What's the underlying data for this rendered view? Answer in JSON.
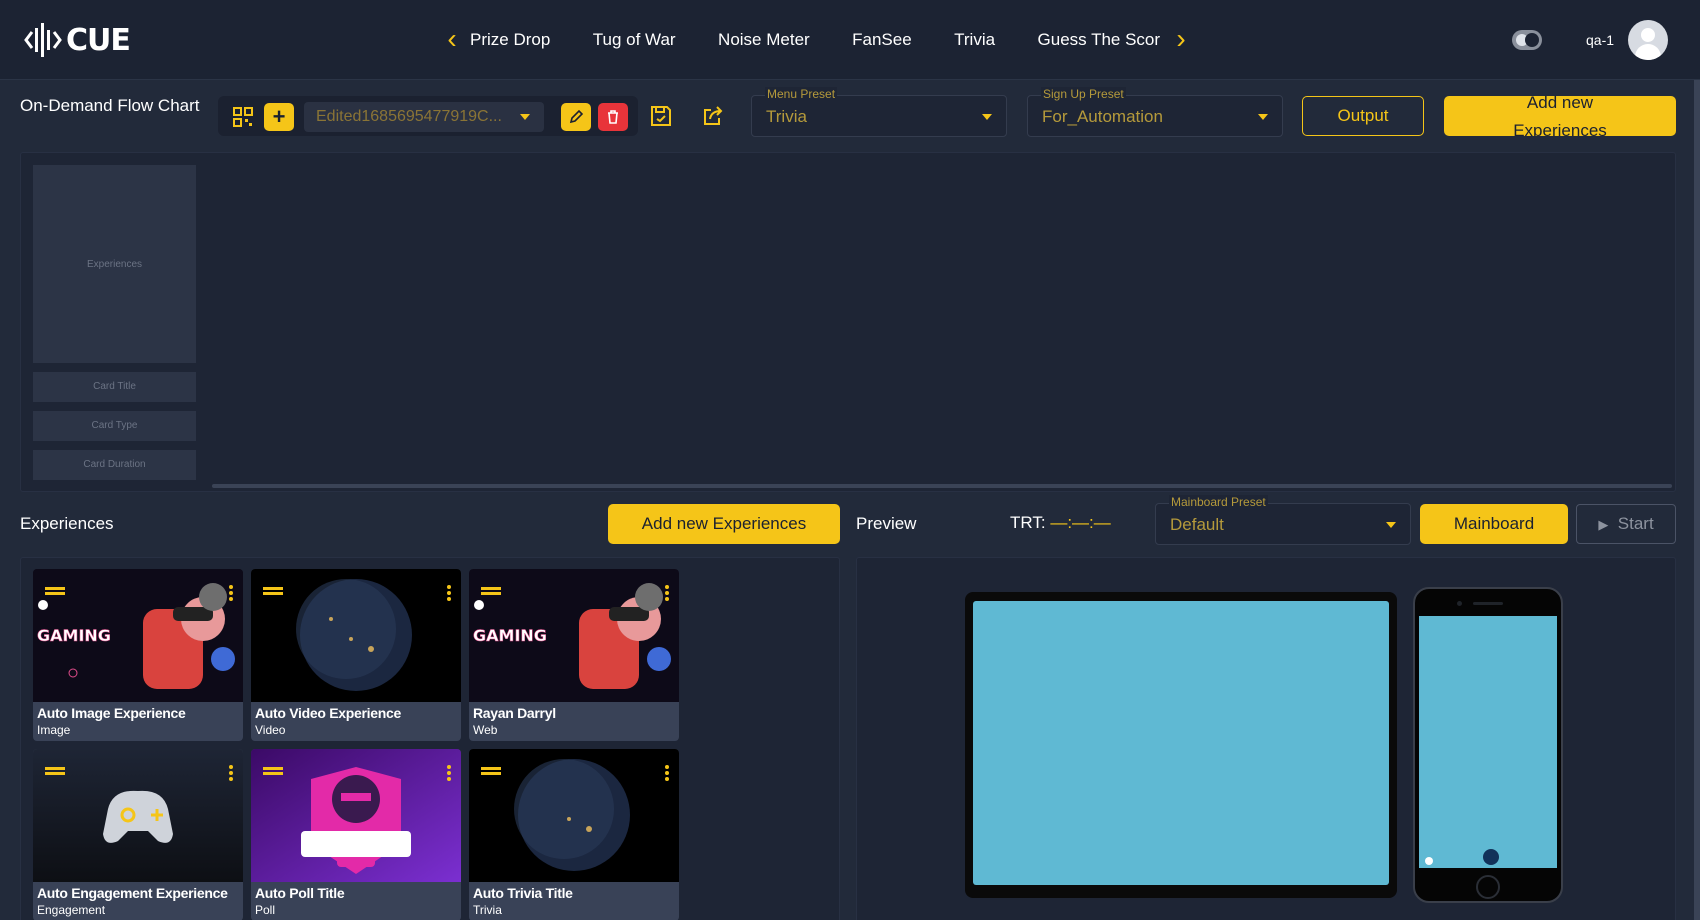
{
  "app": {
    "logo_text": "CUE"
  },
  "nav": {
    "tabs": [
      "Prize Drop",
      "Tug of War",
      "Noise Meter",
      "FanSee",
      "Trivia",
      "Guess The Score"
    ]
  },
  "user": {
    "name": "qa-1"
  },
  "flow": {
    "title": "On-Demand Flow Chart",
    "selected_flow": "Edited1685695477919C...",
    "menu_preset": {
      "label": "Menu Preset",
      "value": "Trivia"
    },
    "signup_preset": {
      "label": "Sign Up Preset",
      "value": "For_Automation"
    },
    "output_label": "Output",
    "add_new_label": "Add new Experiences",
    "placeholder": {
      "image": "Experiences",
      "card_title": "Card Title",
      "card_type": "Card Type",
      "card_duration": "Card Duration"
    }
  },
  "experiences": {
    "title": "Experiences",
    "add_label": "Add new Experiences",
    "cards": [
      {
        "title": "Auto Image Experience",
        "type": "Image"
      },
      {
        "title": "Auto Video Experience",
        "type": "Video"
      },
      {
        "title": "Rayan Darryl",
        "type": "Web"
      },
      {
        "title": "Auto Engagement Experience",
        "type": "Engagement"
      },
      {
        "title": "Auto Poll Title",
        "type": "Poll"
      },
      {
        "title": "Auto Trivia Title",
        "type": "Trivia"
      }
    ]
  },
  "preview": {
    "title": "Preview",
    "trt_label": "TRT:",
    "trt_value": "—:—:—",
    "mainboard_preset": {
      "label": "Mainboard Preset",
      "value": "Default"
    },
    "mainboard_label": "Mainboard",
    "start_label": "Start"
  },
  "colors": {
    "accent": "#f5c518",
    "background": "#222a3a",
    "panel": "#1e2535",
    "preview_screen": "#5fb9d3",
    "delete": "#e8343a"
  },
  "icons": [
    "sound-wave-logo-icon",
    "chevron-left-icon",
    "chevron-right-icon",
    "theme-toggle-icon",
    "user-avatar-icon",
    "qr-grid-icon",
    "plus-icon",
    "pencil-icon",
    "trash-icon",
    "save-icon",
    "share-icon",
    "play-icon",
    "drag-handle-icon",
    "kebab-menu-icon"
  ]
}
